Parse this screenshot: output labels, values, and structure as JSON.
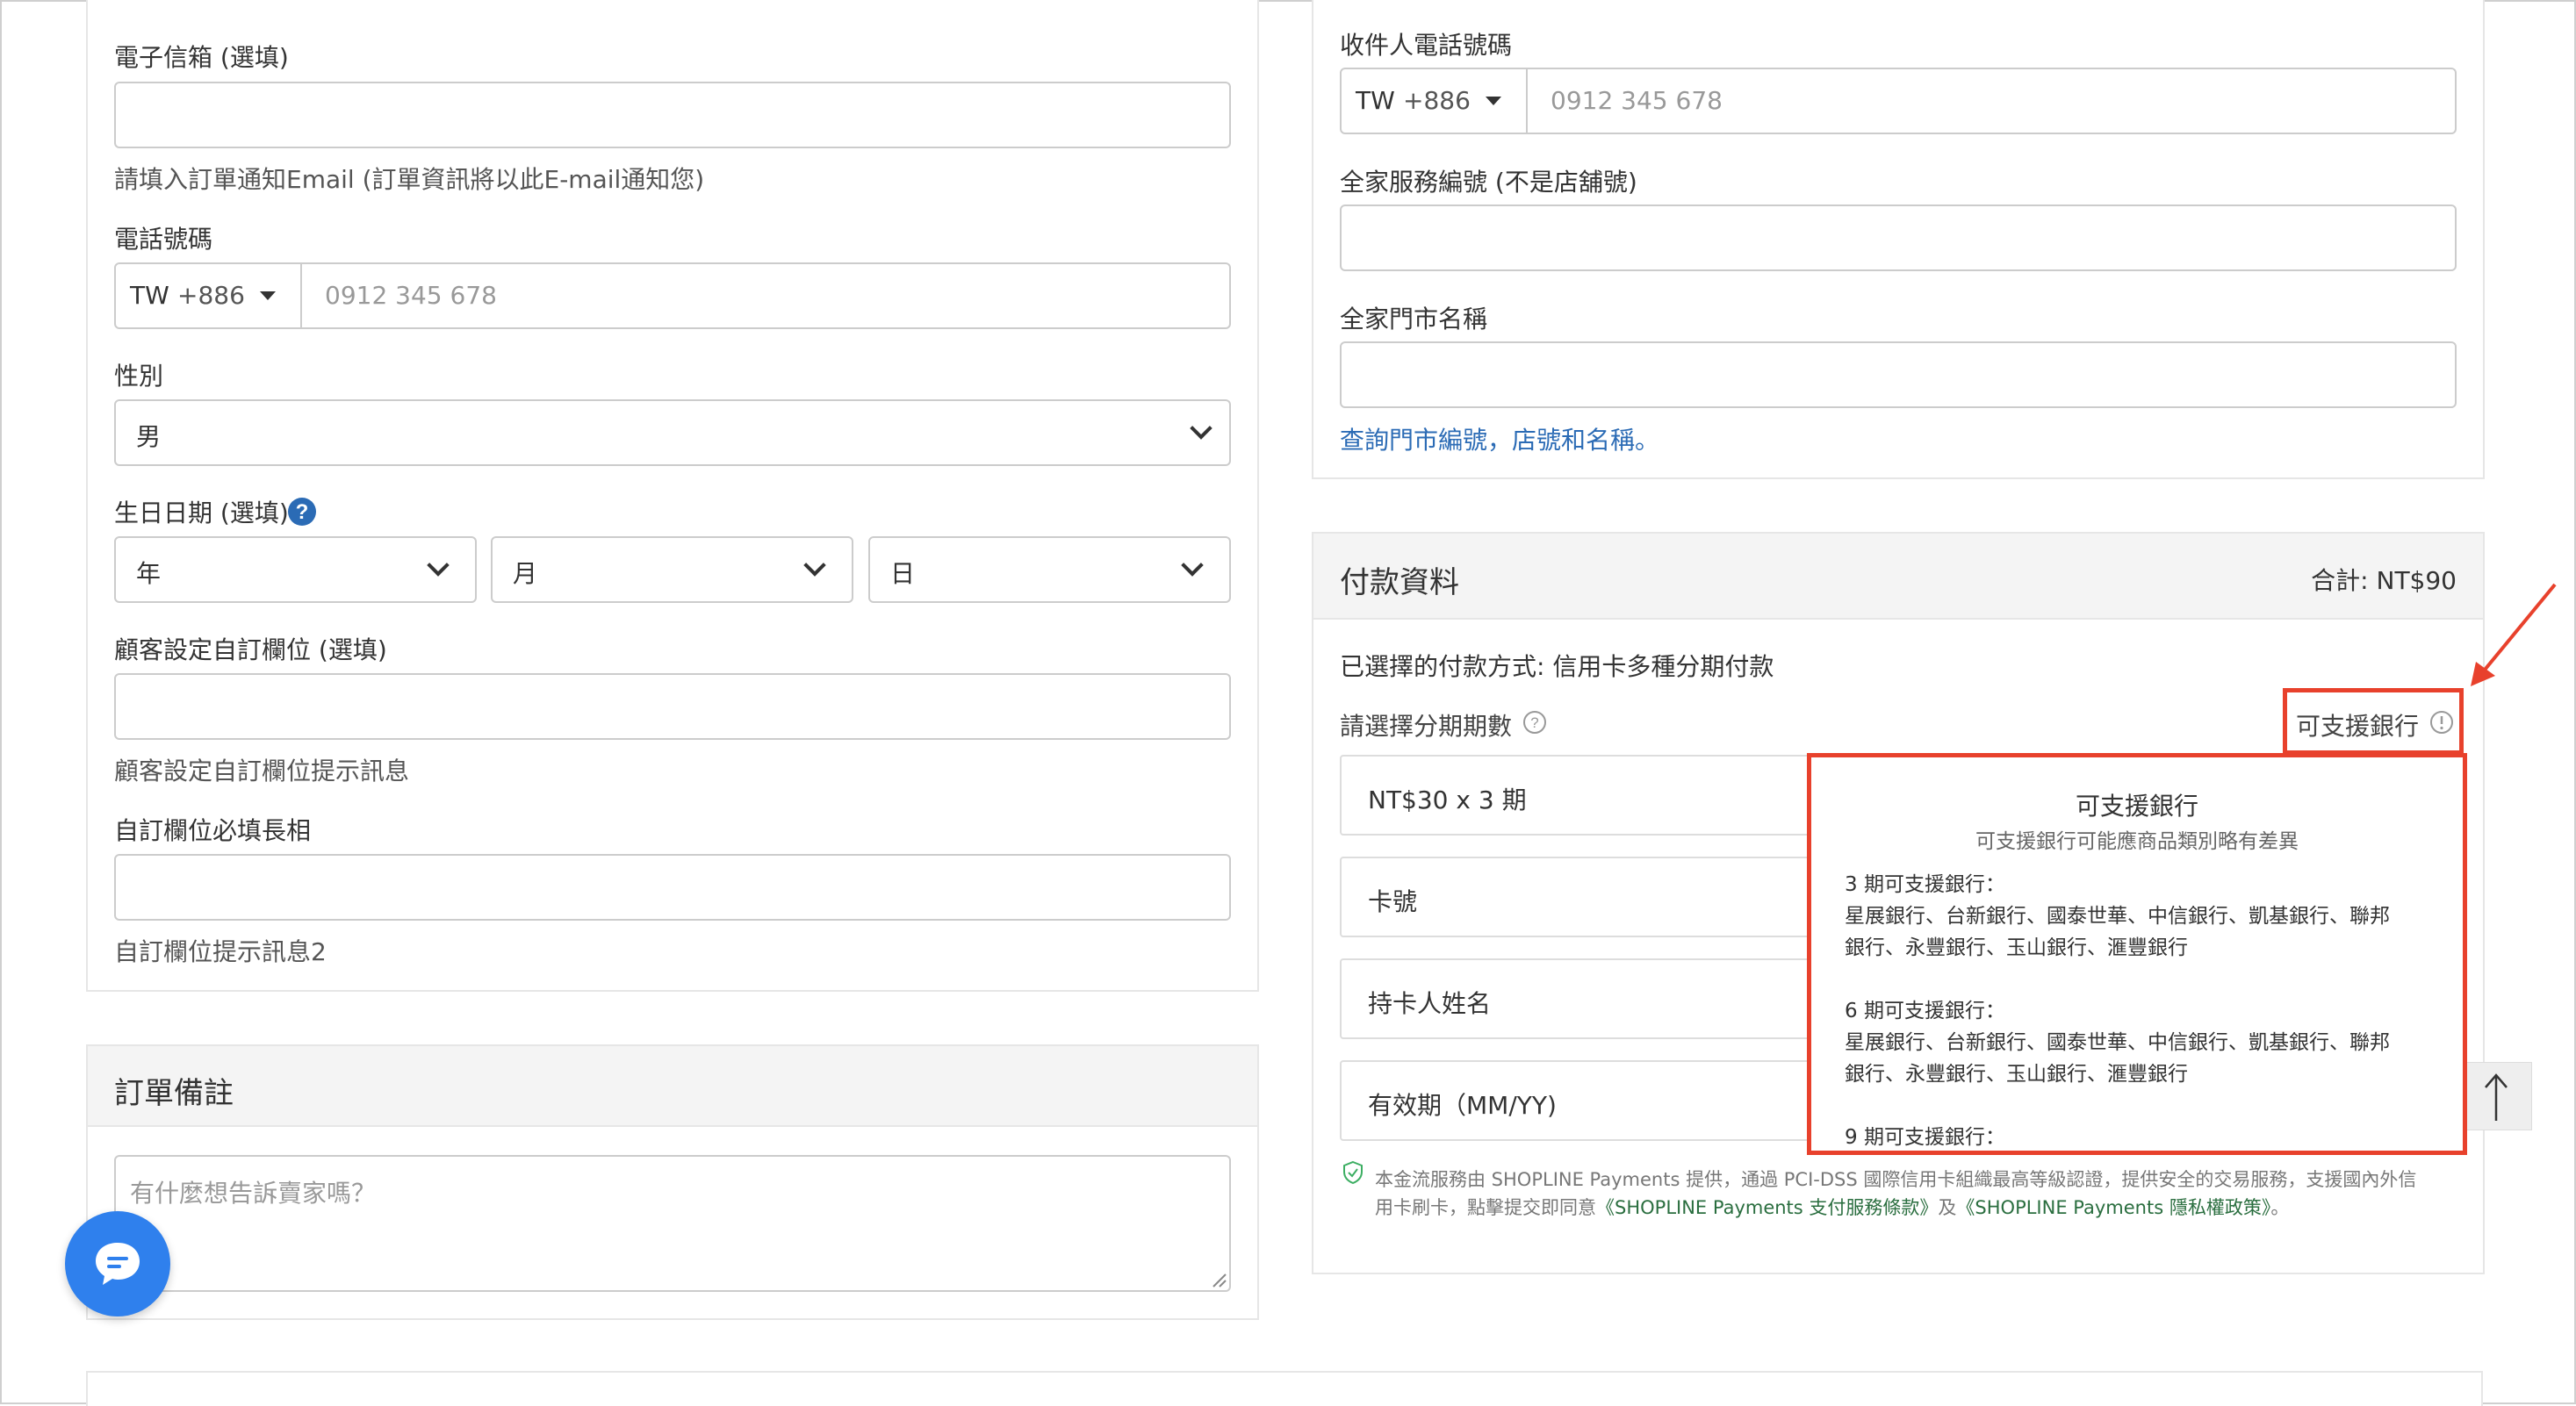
{
  "left_form": {
    "email_label": "電子信箱 (選填)",
    "email_hint": "請填入訂單通知Email (訂單資訊將以此E-mail通知您)",
    "phone_label": "電話號碼",
    "phone_country": "TW",
    "phone_code": "+886",
    "phone_placeholder": "0912 345 678",
    "gender_label": "性別",
    "gender_value": "男",
    "birthday_label": "生日日期 (選填)",
    "birthday_year": "年",
    "birthday_month": "月",
    "birthday_day": "日",
    "custom_field_label": "顧客設定自訂欄位 (選填)",
    "custom_field_hint": "顧客設定自訂欄位提示訊息",
    "required_field_label": "自訂欄位必填長相",
    "required_field_hint": "自訂欄位提示訊息2"
  },
  "order_note": {
    "title": "訂單備註",
    "placeholder": "有什麼想告訴賣家嗎？"
  },
  "right_form": {
    "recipient_phone_label": "收件人電話號碼",
    "phone_country": "TW",
    "phone_code": "+886",
    "phone_placeholder": "0912 345 678",
    "service_no_label": "全家服務編號 (不是店舖號)",
    "store_name_label": "全家門市名稱",
    "lookup_link": "查詢門市編號，店號和名稱。"
  },
  "payment": {
    "title": "付款資料",
    "total": "合計: NT$90",
    "selected_method": "已選擇的付款方式: 信用卡多種分期付款",
    "installment_label": "請選擇分期期數",
    "supported_banks_link": "可支援銀行",
    "installment_value": "NT$30 x 3 期",
    "card_number": "卡號",
    "card_holder": "持卡人姓名",
    "expiry": "有效期（MM/YY)",
    "disclaimer_line1": "本金流服務由 SHOPLINE Payments 提供，通過 PCI-DSS 國際信用卡組織最高等級認證，提供安全的交易服務，支援國內外信",
    "disclaimer_line2_prefix": "用卡刷卡，點擊提交即同意",
    "terms_link": "《SHOPLINE Payments 支付服務條款》",
    "and": "及",
    "privacy_link": "《SHOPLINE Payments 隱私權政策》",
    "period": "。"
  },
  "tooltip": {
    "title": "可支援銀行",
    "subtitle": "可支援銀行可能應商品類別略有差異",
    "p3_title": "3 期可支援銀行：",
    "p3_line1": "星展銀行、台新銀行、國泰世華、中信銀行、凱基銀行、聯邦",
    "p3_line2": "銀行、永豐銀行、玉山銀行、滙豐銀行",
    "p6_title": "6 期可支援銀行：",
    "p6_line1": "星展銀行、台新銀行、國泰世華、中信銀行、凱基銀行、聯邦",
    "p6_line2": "銀行、永豐銀行、玉山銀行、滙豐銀行",
    "p9_title": "9 期可支援銀行："
  },
  "colors": {
    "annotation_red": "#e8412c",
    "link_blue": "#2b6bb5",
    "chat_blue": "#2f80ed",
    "secure_green": "#3cae62"
  },
  "icons": {
    "help": "question-circle-icon",
    "info": "info-circle-icon",
    "chat": "chat-bubble-icon",
    "arrow_up": "arrow-up-icon",
    "shield": "shield-check-icon"
  }
}
